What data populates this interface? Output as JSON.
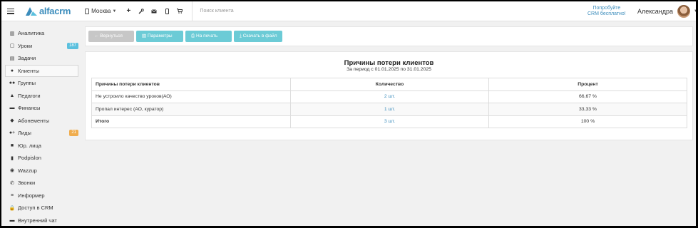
{
  "header": {
    "logo_text": "alfacrm",
    "branch": "Москва",
    "search_placeholder": "Поиск клиента",
    "promo_line1": "Попробуйте",
    "promo_line2": "CRM бесплатно!",
    "user_name": "Александра",
    "icons": [
      "menu-icon",
      "plus-icon",
      "wrench-icon",
      "envelope-icon",
      "mobile-icon",
      "cart-icon"
    ]
  },
  "sidebar": {
    "items": [
      {
        "label": "Аналитика",
        "icon": "chart-icon",
        "glyph": "▥"
      },
      {
        "label": "Уроки",
        "icon": "calendar-icon",
        "glyph": "▢",
        "badge": "187",
        "badge_color": "#5bc0de"
      },
      {
        "label": "Задачи",
        "icon": "tasks-icon",
        "glyph": "▤"
      },
      {
        "label": "Клиенты",
        "icon": "user-icon",
        "glyph": "●",
        "active": true
      },
      {
        "label": "Группы",
        "icon": "users-icon",
        "glyph": "●●"
      },
      {
        "label": "Педагоги",
        "icon": "graduation-cap-icon",
        "glyph": "▲"
      },
      {
        "label": "Финансы",
        "icon": "money-icon",
        "glyph": "▬"
      },
      {
        "label": "Абонементы",
        "icon": "tag-icon",
        "glyph": "◆"
      },
      {
        "label": "Лиды",
        "icon": "user-plus-icon",
        "glyph": "●+",
        "badge": "21",
        "badge_color": "#f0ad4e"
      },
      {
        "label": "Юр. лица",
        "icon": "briefcase-icon",
        "glyph": "■"
      },
      {
        "label": "Podpislon",
        "icon": "file-icon",
        "glyph": "▮"
      },
      {
        "label": "Wazzup",
        "icon": "whatsapp-icon",
        "glyph": "◉"
      },
      {
        "label": "Звонки",
        "icon": "phone-icon",
        "glyph": "✆"
      },
      {
        "label": "Информер",
        "icon": "list-icon",
        "glyph": "≡"
      },
      {
        "label": "Доступ в CRM",
        "icon": "lock-icon",
        "glyph": "🔒"
      },
      {
        "label": "Внутренний чат",
        "icon": "chat-icon",
        "glyph": "▬"
      }
    ]
  },
  "toolbar": {
    "back_label": "← Вернуться",
    "params_label": "Параметры",
    "print_label": "На печать",
    "download_label": "Скачать в файл"
  },
  "report": {
    "title": "Причины потери клиентов",
    "subtitle": "За период с 01.01.2025 по 31.01.2025",
    "columns": [
      "Причины потери клиентов",
      "Количество",
      "Процент"
    ],
    "rows": [
      {
        "reason": "Не устроило качество уроков(АО)",
        "count": "2 шт.",
        "percent": "66,67 %"
      },
      {
        "reason": "Пропал интерес (АО, куратор)",
        "count": "1 шт.",
        "percent": "33,33 %"
      },
      {
        "reason": "Итого",
        "count": "3 шт.",
        "percent": "100 %"
      }
    ]
  }
}
